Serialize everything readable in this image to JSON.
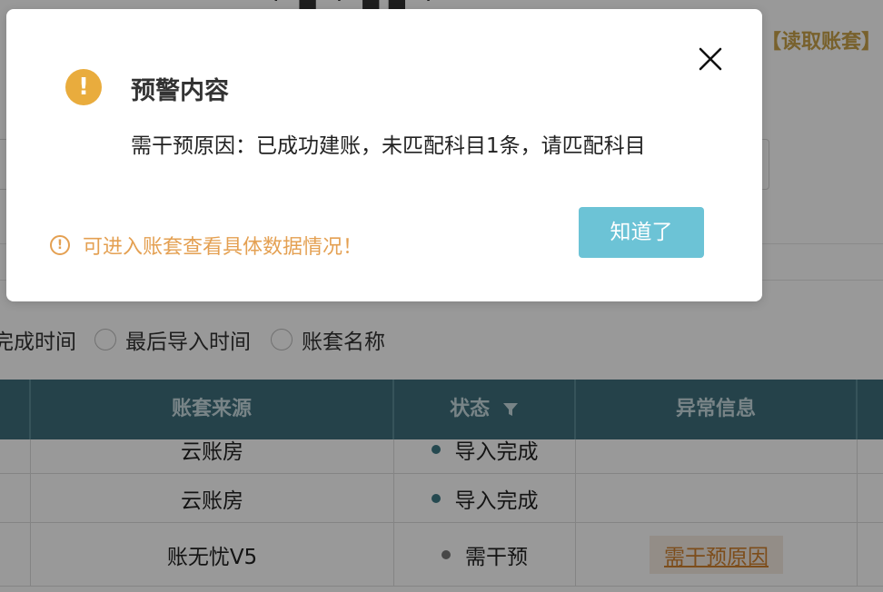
{
  "background": {
    "title_fragment": "· ■ · ■■ ·",
    "read_account_link": "【读取账套】",
    "sort_options": {
      "partial_label": "完成时间",
      "options": [
        "最后导入时间",
        "账套名称"
      ]
    },
    "table": {
      "headers": {
        "source": "账套来源",
        "status": "状态",
        "abnormal": "异常信息"
      },
      "rows": [
        {
          "source": "云账房",
          "status": "导入完成",
          "abnormal": ""
        },
        {
          "source": "云账房",
          "status": "导入完成",
          "abnormal": ""
        },
        {
          "source": "账无忧V5",
          "status": "需干预",
          "abnormal": "需干预原因"
        }
      ]
    }
  },
  "dialog": {
    "icon": "warning-icon",
    "title": "预警内容",
    "message": "需干预原因：已成功建账，未匹配科目1条，请匹配科目",
    "hint_icon": "info-circle-icon",
    "hint": "可进入账套查看具体数据情况！",
    "ok_button": "知道了",
    "close_icon": "close-icon"
  },
  "colors": {
    "table_header": "#3f6f7c",
    "status_done_dot": "#3f7a86",
    "status_intervene_dot": "#777777",
    "ok_button": "#6cc3d6",
    "warning": "#e9ac3d",
    "hint": "#e4a052",
    "link_gold": "#c9a24a"
  }
}
